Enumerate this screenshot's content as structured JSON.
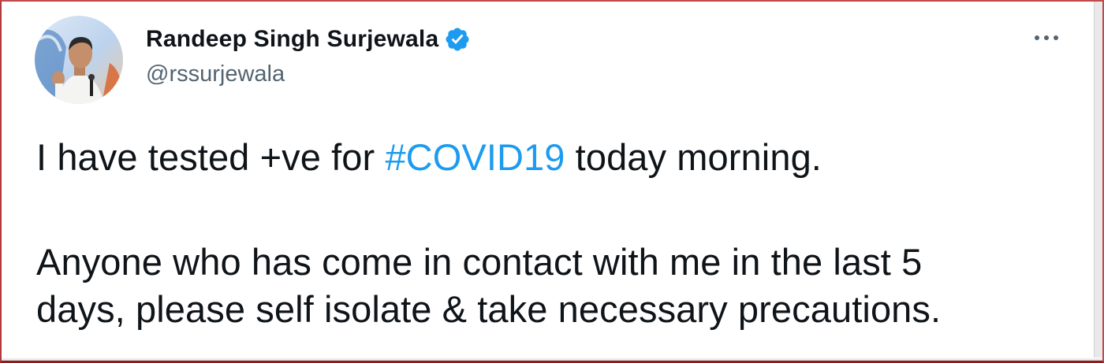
{
  "tweet": {
    "author": {
      "display_name": "Randeep Singh Surjewala",
      "handle": "@rssurjewala",
      "verified_icon": "verified-badge-icon",
      "avatar_icon": "profile-photo"
    },
    "menu_icon": "more-options-icon",
    "body": {
      "line1_before": "I have tested +ve for ",
      "hashtag": "#COVID19",
      "line1_after": " today morning.",
      "paragraph2_line1": "Anyone who has come in contact with me in the last 5",
      "paragraph2_line2": "days, please self isolate & take necessary precautions."
    }
  },
  "colors": {
    "text": "#0f1419",
    "secondary_text": "#536471",
    "link": "#1d9bf0",
    "verified": "#1d9bf0",
    "frame_border": "#b23a3a"
  }
}
